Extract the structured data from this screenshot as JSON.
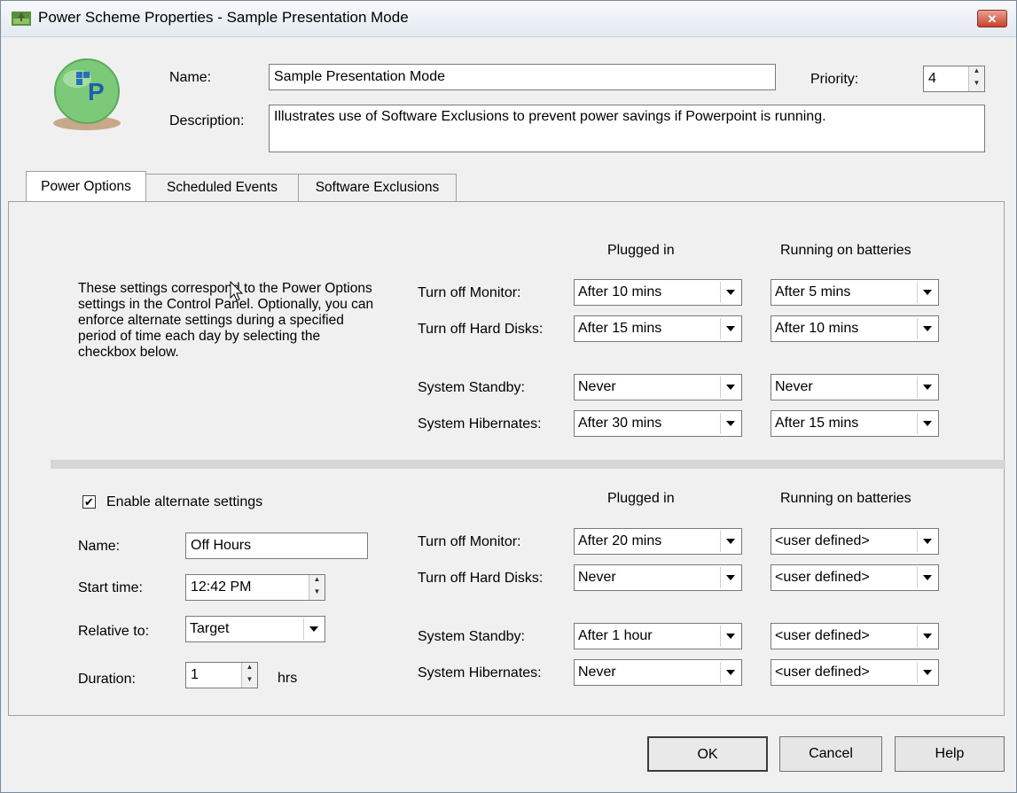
{
  "window": {
    "title": "Power Scheme Properties - Sample Presentation Mode",
    "close_label": "✕"
  },
  "header": {
    "name_label": "Name:",
    "name_value": "Sample Presentation Mode",
    "priority_label": "Priority:",
    "priority_value": "4",
    "description_label": "Description:",
    "description_value": "Illustrates use of Software Exclusions to prevent power savings if Powerpoint is running."
  },
  "tabs": [
    {
      "label": "Power Options",
      "active": true
    },
    {
      "label": "Scheduled Events",
      "active": false
    },
    {
      "label": "Software Exclusions",
      "active": false
    }
  ],
  "primary": {
    "description": "These settings correspond to the Power Options settings in the Control Panel. Optionally, you can enforce alternate settings during a specified period of time each day by selecting the checkbox below.",
    "col_plugged": "Plugged in",
    "col_battery": "Running on batteries",
    "rows": [
      {
        "label": "Turn off Monitor:",
        "plugged": "After 10 mins",
        "battery": "After 5 mins"
      },
      {
        "label": "Turn off Hard Disks:",
        "plugged": "After 15 mins",
        "battery": "After 10 mins"
      },
      {
        "label": "System Standby:",
        "plugged": "Never",
        "battery": "Never"
      },
      {
        "label": "System Hibernates:",
        "plugged": "After 30 mins",
        "battery": "After 15 mins"
      }
    ]
  },
  "alternate": {
    "enable_label": "Enable alternate settings",
    "enabled": true,
    "check_mark": "✔",
    "name_label": "Name:",
    "name_value": "Off Hours",
    "start_label": "Start time:",
    "start_value": "12:42 PM",
    "relative_label": "Relative to:",
    "relative_value": "Target",
    "duration_label": "Duration:",
    "duration_value": "1",
    "duration_unit": "hrs",
    "col_plugged": "Plugged in",
    "col_battery": "Running on batteries",
    "rows": [
      {
        "label": "Turn off Monitor:",
        "plugged": "After 20 mins",
        "battery": "<user defined>"
      },
      {
        "label": "Turn off Hard Disks:",
        "plugged": "Never",
        "battery": "<user defined>"
      },
      {
        "label": "System Standby:",
        "plugged": "After 1 hour",
        "battery": "<user defined>"
      },
      {
        "label": "System Hibernates:",
        "plugged": "Never",
        "battery": "<user defined>"
      }
    ]
  },
  "buttons": {
    "ok": "OK",
    "cancel": "Cancel",
    "help": "Help"
  }
}
